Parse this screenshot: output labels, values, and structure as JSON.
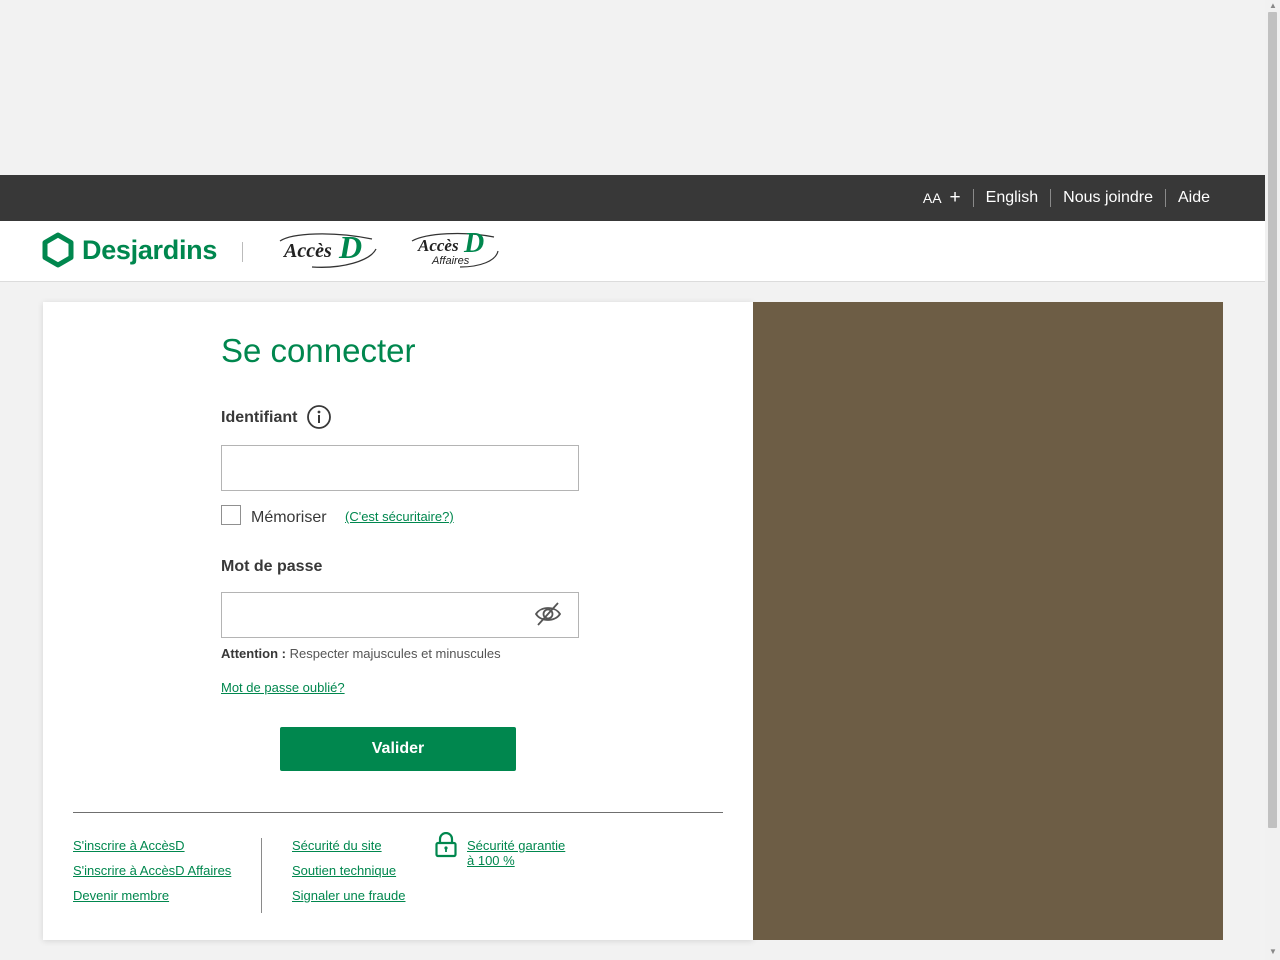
{
  "topbar": {
    "font_size_label": "AA",
    "font_size_plus": "+",
    "language": "English",
    "contact": "Nous joindre",
    "help": "Aide"
  },
  "header": {
    "logo_text": "Desjardins",
    "accesd_text": "Accès",
    "accesd_d": "D",
    "accesd_affaires_text": "Accès",
    "accesd_affaires_d": "D",
    "accesd_affaires_sub": "Affaires"
  },
  "login": {
    "title": "Se connecter",
    "identifier_label": "Identifiant",
    "identifier_value": "",
    "remember_label": "Mémoriser",
    "is_it_safe_link": "(C'est sécuritaire?)",
    "password_label": "Mot de passe",
    "password_value": "",
    "attention_label": "Attention",
    "attention_sep": " : ",
    "attention_text": "Respecter majuscules et minuscules",
    "forgot_password": "Mot de passe oublié?",
    "submit": "Valider"
  },
  "footer": {
    "col1": [
      "S'inscrire à AccèsD",
      "S'inscrire à AccèsD Affaires",
      "Devenir membre"
    ],
    "col2": [
      "Sécurité du site",
      "Soutien technique",
      "Signaler une fraude"
    ],
    "guarantee_line1": "Sécurité garantie",
    "guarantee_line2": "à 100 %"
  },
  "colors": {
    "brand_green": "#00874e",
    "topbar": "#383838",
    "side_panel": "#6d5d45",
    "background": "#f2f2f2"
  },
  "icons": [
    "hexagon-logo-icon",
    "info-icon",
    "eye-slash-icon",
    "lock-icon"
  ]
}
